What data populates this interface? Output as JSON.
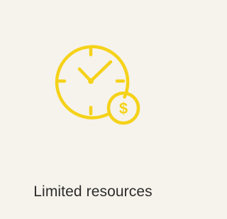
{
  "card": {
    "label": "Limited resources",
    "icon": "clock-with-dollar-coin-icon",
    "accent_color": "#f5d21a",
    "background_color": "#f6f3ec",
    "coin_symbol": "$"
  }
}
